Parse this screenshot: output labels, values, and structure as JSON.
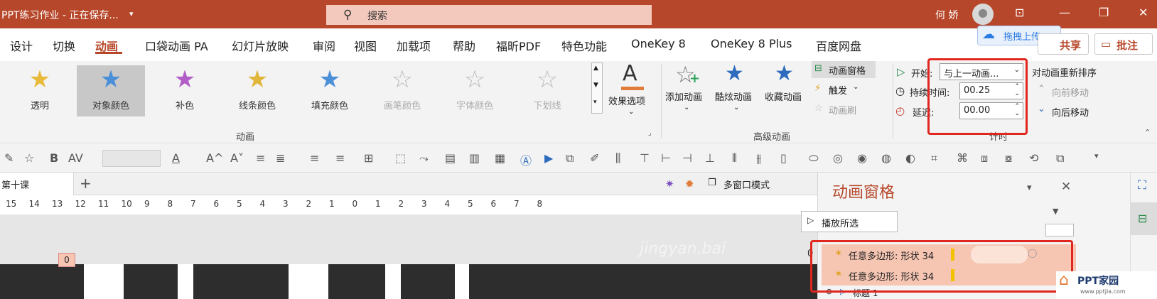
{
  "window": {
    "title": "PPT练习作业 - 正在保存...",
    "search_placeholder": "搜索",
    "user_name": "何 娇",
    "upload_badge": "拖拽上传",
    "share_label": "共享",
    "comment_label": "批注"
  },
  "menu": [
    "设计",
    "切换",
    "动画",
    "口袋动画 PA",
    "幻灯片放映",
    "审阅",
    "视图",
    "加载项",
    "帮助",
    "福昕PDF",
    "特色功能",
    "OneKey 8",
    "OneKey 8 Plus",
    "百度网盘"
  ],
  "gallery": {
    "items": [
      {
        "label": "透明"
      },
      {
        "label": "对象颜色"
      },
      {
        "label": "补色"
      },
      {
        "label": "线条颜色"
      },
      {
        "label": "填充颜色"
      },
      {
        "label": "画笔颜色"
      },
      {
        "label": "字体颜色"
      },
      {
        "label": "下划线"
      }
    ],
    "group_label": "动画",
    "effect_options": "效果选项"
  },
  "advanced": {
    "add_animation": "添加动画",
    "cool_animation": "酷炫动画",
    "favorite_animation": "收藏动画",
    "animation_pane": "动画窗格",
    "trigger": "触发",
    "animation_brush": "动画刷",
    "group_label": "高级动画"
  },
  "timing": {
    "start_label": "开始:",
    "start_value": "与上一动画...",
    "duration_label": "持续时间:",
    "duration_value": "00.25",
    "delay_label": "延迟:",
    "delay_value": "00.00",
    "reorder_title": "对动画重新排序",
    "move_earlier": "向前移动",
    "move_later": "向后移动",
    "group_label": "计时"
  },
  "tabs": {
    "doc_tab": "第十课",
    "multi_window": "多窗口模式"
  },
  "ruler": [
    "15",
    "14",
    "13",
    "12",
    "11",
    "10",
    "9",
    "8",
    "7",
    "6",
    "5",
    "4",
    "3",
    "2",
    "1",
    "0",
    "1",
    "2",
    "3",
    "4",
    "5",
    "6",
    "7",
    "8"
  ],
  "slide": {
    "tag": "0",
    "watermark": "jingyan.bai"
  },
  "pane": {
    "title": "动画窗格",
    "play_label": "播放所选",
    "items": [
      {
        "index": "0",
        "label": "任意多边形: 形状 34"
      },
      {
        "index": "",
        "label": "任意多边形: 形状 34"
      }
    ],
    "next_label": "标题 1"
  },
  "brand": {
    "name": "PPT家园",
    "url": "www.pptjia.com"
  },
  "colors": {
    "accent": "#b7472a",
    "highlight_box": "#e0261f",
    "pane_row": "#f6c6b3"
  }
}
